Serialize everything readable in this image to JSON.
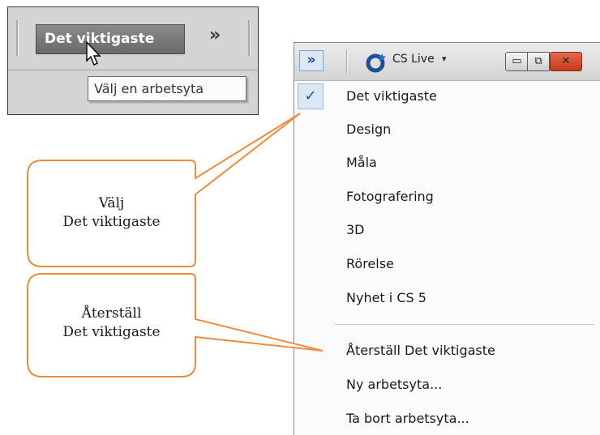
{
  "inset": {
    "workspace_button": "Det viktigaste",
    "chevron": "»",
    "tooltip": "Välj en arbetsyta"
  },
  "toolbar": {
    "chevron": "»",
    "cs_live": "CS Live",
    "cs_caret": "▾",
    "minimize": "▭",
    "restore": "⧉",
    "close": "✕"
  },
  "menu": {
    "items": [
      {
        "label": "Det viktigaste",
        "checked": true
      },
      {
        "label": "Design"
      },
      {
        "label": "Måla"
      },
      {
        "label": "Fotografering"
      },
      {
        "label": "3D"
      },
      {
        "label": "Rörelse"
      },
      {
        "label": "Nyhet i CS 5"
      },
      {
        "label": "Återställ Det viktigaste"
      },
      {
        "label": "Ny arbetsyta..."
      },
      {
        "label": "Ta bort arbetsyta..."
      }
    ],
    "checkmark": "✓"
  },
  "callouts": [
    {
      "line1": "Välj",
      "line2": "Det viktigaste"
    },
    {
      "line1": "Återställ",
      "line2": "Det viktigaste"
    }
  ],
  "colors": {
    "callout_stroke": "#f08a3c",
    "check_blue": "#1b4fa3"
  }
}
